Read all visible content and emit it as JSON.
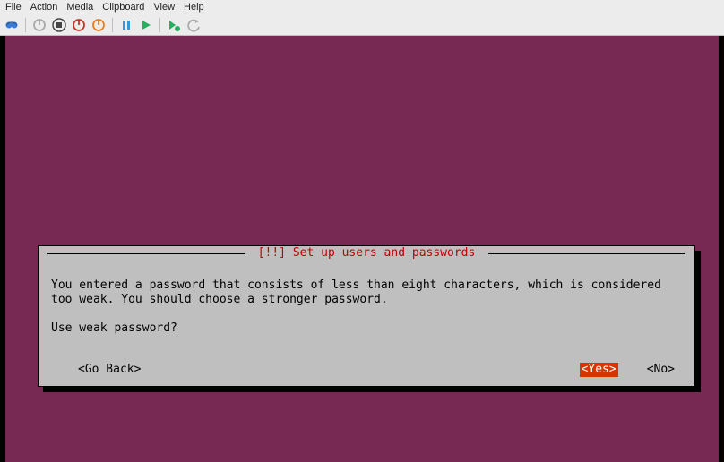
{
  "menubar": {
    "file": "File",
    "action": "Action",
    "media": "Media",
    "clipboard": "Clipboard",
    "view": "View",
    "help": "Help"
  },
  "toolbar": {
    "icons": {
      "connect": "connect-icon",
      "poweroff_grey": "poweroff-grey-icon",
      "stop": "stop-icon",
      "shutdown": "shutdown-icon",
      "poweron": "poweron-icon",
      "pause": "pause-icon",
      "play": "play-icon",
      "checkpoint": "checkpoint-icon",
      "revert": "revert-icon"
    }
  },
  "dialog": {
    "title_prefix": "[!!]",
    "title_text": "Set up users and passwords",
    "body_line1": "You entered a password that consists of less than eight characters, which is considered",
    "body_line2": "too weak. You should choose a stronger password.",
    "prompt": "Use weak password?",
    "go_back": "<Go Back>",
    "yes": "<Yes>",
    "no": "<No>"
  }
}
